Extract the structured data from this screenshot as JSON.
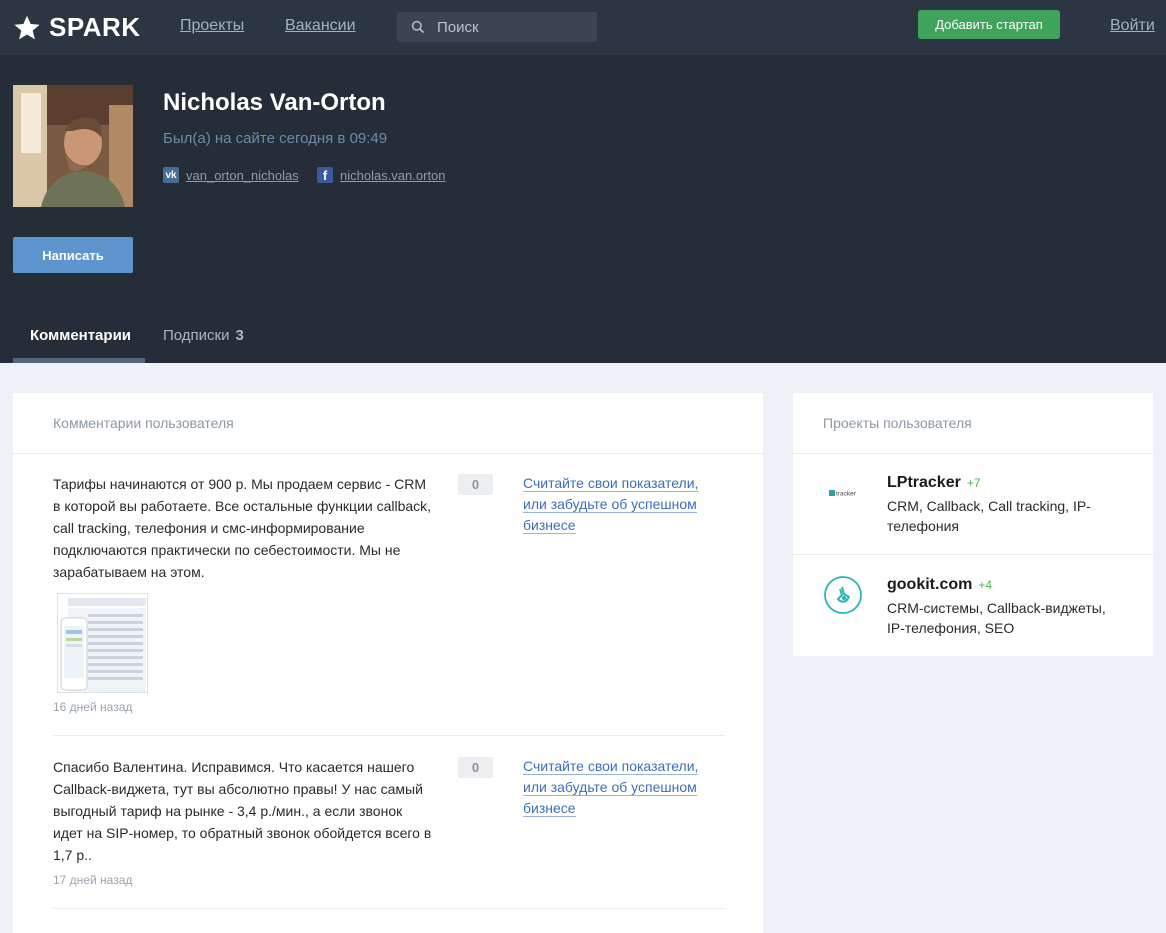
{
  "header": {
    "logo": "SPARK",
    "nav": {
      "projects": "Проекты",
      "vacancies": "Вакансии"
    },
    "search": {
      "placeholder": "Поиск",
      "value": ""
    },
    "add_startup_label": "Добавить стартап",
    "login_label": "Войти",
    "colors": {
      "bar": "#2c3542",
      "add_button": "#3fa35b"
    }
  },
  "profile": {
    "name": "Nicholas Van-Orton",
    "last_seen": "Был(а) на сайте сегодня в 09:49",
    "social": {
      "vk": "van_orton_nicholas",
      "facebook": "nicholas.van.orton"
    },
    "write_label": "Написать",
    "tabs": [
      {
        "label": "Комментарии",
        "active": true
      },
      {
        "label": "Подписки",
        "count": "3",
        "active": false
      }
    ]
  },
  "comments": {
    "title": "Комментарии пользователя",
    "items": [
      {
        "text": "Тарифы начинаются от 900 р. Мы продаем сервис - CRM в которой вы работаете. Все остальные функции callback, call tracking, телефония и смс-информирование подключаются практически по себестоимости. Мы не зарабатываем на этом.",
        "votes": "0",
        "link": "Считайте свои показатели, или забудьте об успешном бизнесе",
        "date": "16 дней назад",
        "has_image": true
      },
      {
        "text": "Спасибо Валентина. Исправимся. Что касается нашего Callback-виджета, тут вы абсолютно правы! У нас самый выгодный тариф на рынке - 3,4 р./мин., а если звонок идет на SIP-номер, то обратный звонок обойдется всего в 1,7 р..",
        "votes": "0",
        "link": "Считайте свои показатели, или забудьте об успешном бизнесе",
        "date": "17 дней назад",
        "has_image": false
      }
    ]
  },
  "projects": {
    "title": "Проекты пользователя",
    "items": [
      {
        "name": "LPtracker",
        "score": "+7",
        "description": "CRM, Callback, Call tracking, IP-телефония",
        "logo_text": "tracker",
        "icon": "lptracker-logo"
      },
      {
        "name": "gookit.com",
        "score": "+4",
        "description": "CRM-системы, Callback-виджеты, IP-телефония, SEO",
        "icon": "gookit-logo"
      }
    ]
  }
}
